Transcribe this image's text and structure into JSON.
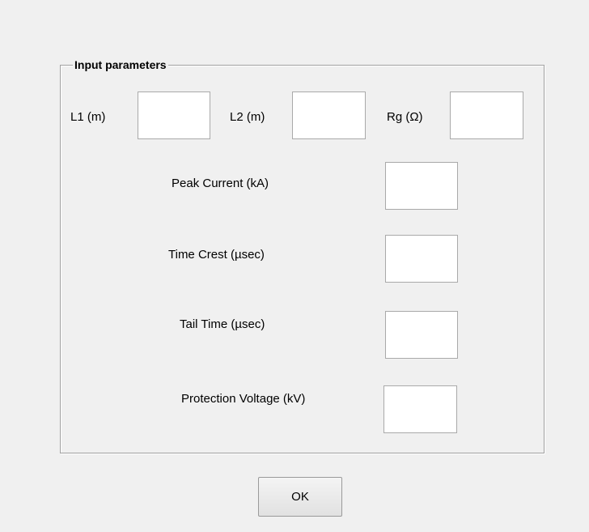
{
  "panel": {
    "title": "Input parameters"
  },
  "fields": {
    "l1": {
      "label": "L1 (m)",
      "value": ""
    },
    "l2": {
      "label": "L2 (m)",
      "value": ""
    },
    "rg": {
      "label": "Rg (Ω)",
      "value": ""
    },
    "peak_current": {
      "label": "Peak Current (kA)",
      "value": ""
    },
    "time_crest": {
      "label": "Time Crest (µsec)",
      "value": ""
    },
    "tail_time": {
      "label": "Tail Time (µsec)",
      "value": ""
    },
    "protection_voltage": {
      "label": "Protection Voltage (kV)",
      "value": ""
    }
  },
  "buttons": {
    "ok_label": "OK"
  }
}
